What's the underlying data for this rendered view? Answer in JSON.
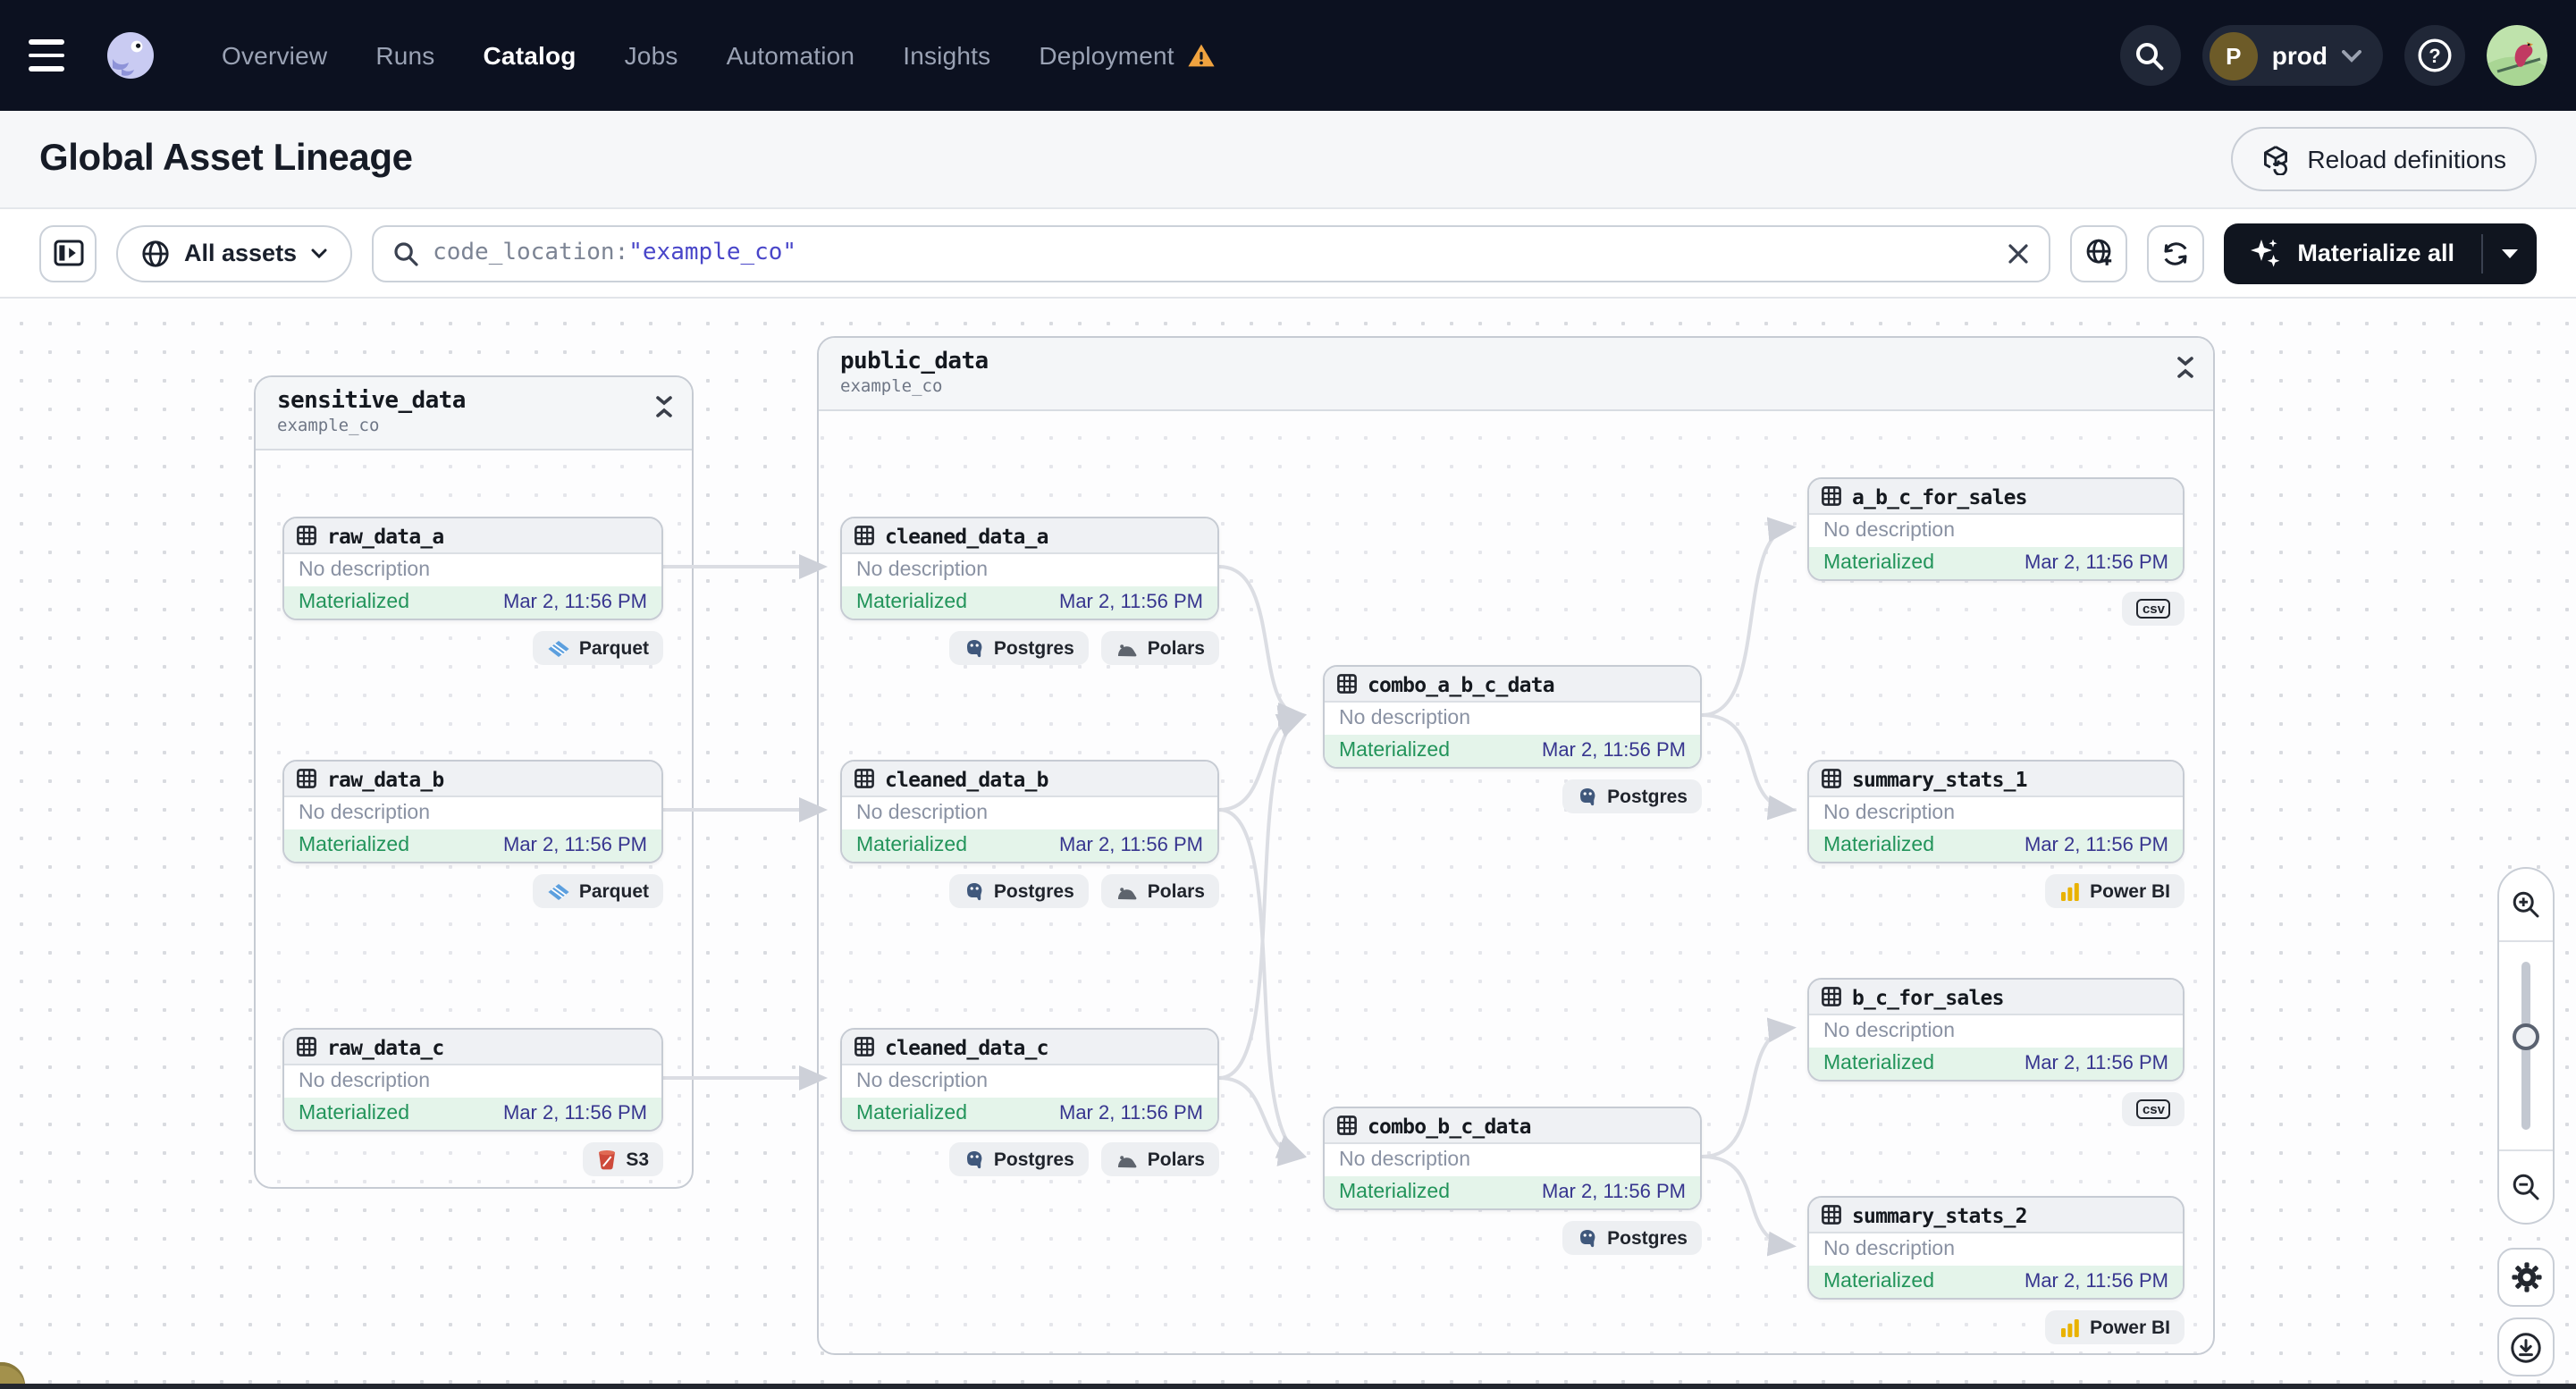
{
  "nav": {
    "menu_items": [
      {
        "label": "Overview",
        "active": false
      },
      {
        "label": "Runs",
        "active": false
      },
      {
        "label": "Catalog",
        "active": true
      },
      {
        "label": "Jobs",
        "active": false
      },
      {
        "label": "Automation",
        "active": false
      },
      {
        "label": "Insights",
        "active": false
      },
      {
        "label": "Deployment",
        "active": false,
        "warning": true
      }
    ],
    "environment": {
      "initial": "P",
      "name": "prod"
    }
  },
  "header": {
    "title": "Global Asset Lineage",
    "reload_button_label": "Reload definitions"
  },
  "toolbar": {
    "scope_label": "All assets",
    "search_field": "code_location:",
    "search_term": "\"example_co\"",
    "materialize_label": "Materialize all"
  },
  "colors": {
    "nav_bg": "#0C1120",
    "warning_amber": "#F0A33F",
    "materialized_green": "#22945A",
    "timestamp_purple": "#37358F",
    "search_term_blue": "#4946C9"
  },
  "graph": {
    "groups": [
      {
        "name": "sensitive_data",
        "location": "example_co"
      },
      {
        "name": "public_data",
        "location": "example_co"
      }
    ],
    "nodes": [
      {
        "name": "raw_data_a",
        "description": "No description",
        "status": "Materialized",
        "date": "Mar 2, 11:56 PM",
        "tags": [
          {
            "type": "parquet",
            "label": "Parquet"
          }
        ]
      },
      {
        "name": "raw_data_b",
        "description": "No description",
        "status": "Materialized",
        "date": "Mar 2, 11:56 PM",
        "tags": [
          {
            "type": "parquet",
            "label": "Parquet"
          }
        ]
      },
      {
        "name": "raw_data_c",
        "description": "No description",
        "status": "Materialized",
        "date": "Mar 2, 11:56 PM",
        "tags": [
          {
            "type": "s3",
            "label": "S3"
          }
        ]
      },
      {
        "name": "cleaned_data_a",
        "description": "No description",
        "status": "Materialized",
        "date": "Mar 2, 11:56 PM",
        "tags": [
          {
            "type": "postgres",
            "label": "Postgres"
          },
          {
            "type": "polars",
            "label": "Polars"
          }
        ]
      },
      {
        "name": "cleaned_data_b",
        "description": "No description",
        "status": "Materialized",
        "date": "Mar 2, 11:56 PM",
        "tags": [
          {
            "type": "postgres",
            "label": "Postgres"
          },
          {
            "type": "polars",
            "label": "Polars"
          }
        ]
      },
      {
        "name": "cleaned_data_c",
        "description": "No description",
        "status": "Materialized",
        "date": "Mar 2, 11:56 PM",
        "tags": [
          {
            "type": "postgres",
            "label": "Postgres"
          },
          {
            "type": "polars",
            "label": "Polars"
          }
        ]
      },
      {
        "name": "combo_a_b_c_data",
        "description": "No description",
        "status": "Materialized",
        "date": "Mar 2, 11:56 PM",
        "tags": [
          {
            "type": "postgres",
            "label": "Postgres"
          }
        ]
      },
      {
        "name": "combo_b_c_data",
        "description": "No description",
        "status": "Materialized",
        "date": "Mar 2, 11:56 PM",
        "tags": [
          {
            "type": "postgres",
            "label": "Postgres"
          }
        ]
      },
      {
        "name": "a_b_c_for_sales",
        "description": "No description",
        "status": "Materialized",
        "date": "Mar 2, 11:56 PM",
        "tags": [
          {
            "type": "csv",
            "label": "csv"
          }
        ]
      },
      {
        "name": "summary_stats_1",
        "description": "No description",
        "status": "Materialized",
        "date": "Mar 2, 11:56 PM",
        "tags": [
          {
            "type": "powerbi",
            "label": "Power BI"
          }
        ]
      },
      {
        "name": "b_c_for_sales",
        "description": "No description",
        "status": "Materialized",
        "date": "Mar 2, 11:56 PM",
        "tags": [
          {
            "type": "csv",
            "label": "csv"
          }
        ]
      },
      {
        "name": "summary_stats_2",
        "description": "No description",
        "status": "Materialized",
        "date": "Mar 2, 11:56 PM",
        "tags": [
          {
            "type": "powerbi",
            "label": "Power BI"
          }
        ]
      }
    ]
  }
}
